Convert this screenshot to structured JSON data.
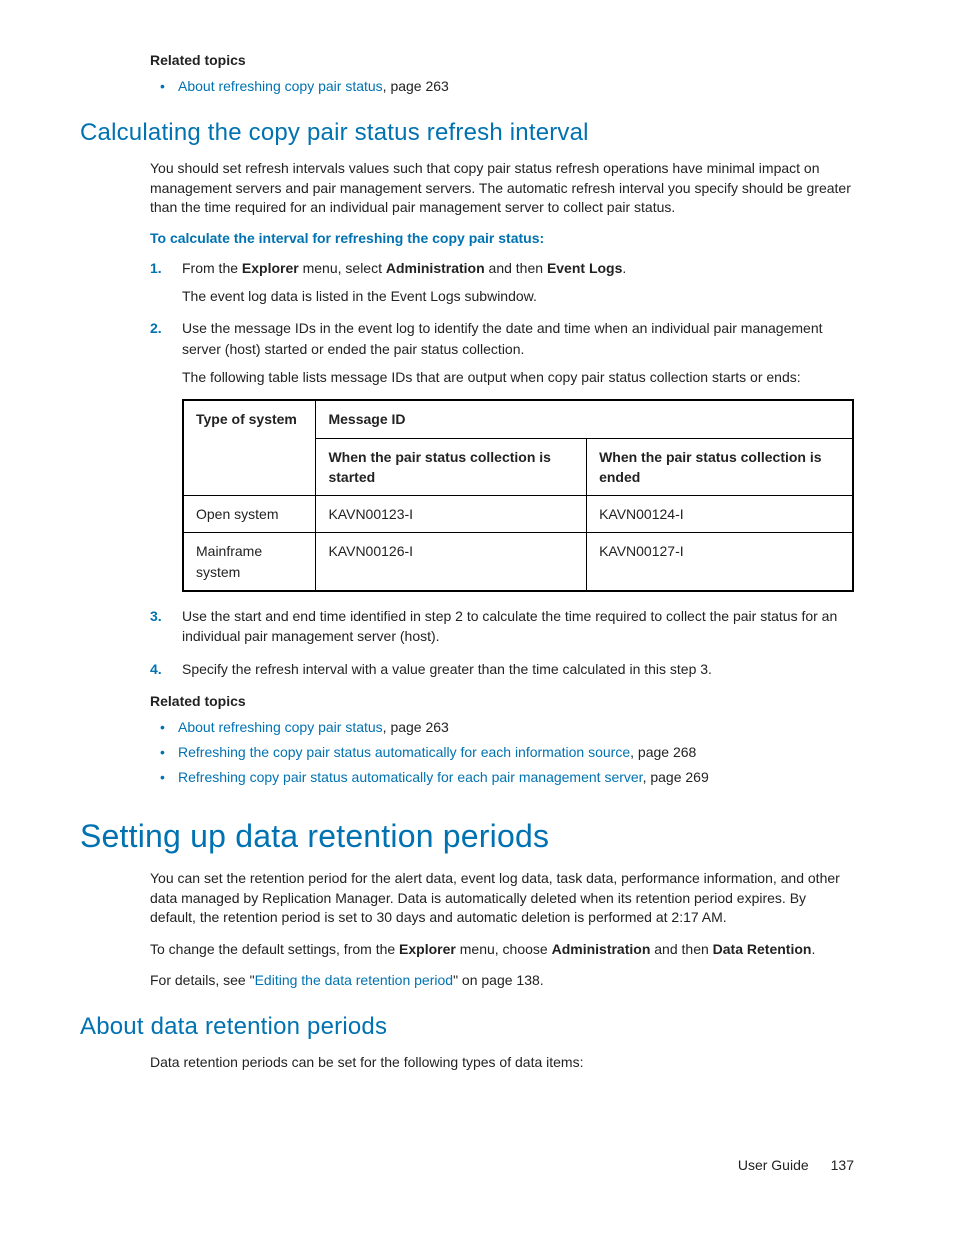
{
  "related1": {
    "heading": "Related topics",
    "items": [
      {
        "link": "About refreshing copy pair status",
        "suffix": ", page 263"
      }
    ]
  },
  "section1": {
    "title": "Calculating the copy pair status refresh interval",
    "p1": "You should set refresh intervals values such that copy pair status refresh operations have minimal impact on management servers and pair management servers. The automatic refresh interval you specify should be greater than the time required for an individual pair management server to collect pair status.",
    "proc_heading": "To calculate the interval for refreshing the copy pair status:",
    "step1_pre": "From the ",
    "step1_b1": "Explorer",
    "step1_mid1": " menu, select ",
    "step1_b2": "Administration",
    "step1_mid2": " and then ",
    "step1_b3": "Event Logs",
    "step1_post": ".",
    "step1_sub": "The event log data is listed in the Event Logs subwindow.",
    "step2": "Use the message IDs in the event log to identify the date and time when an individual pair management server (host) started or ended the pair status collection.",
    "step2_sub": "The following table lists message IDs that are output when copy pair status collection starts or ends:",
    "step3": "Use the start and end time identified in step 2 to calculate the time required to collect the pair status for an individual pair management server (host).",
    "step4": "Specify the refresh interval with a value greater than the time calculated in this step 3."
  },
  "table": {
    "h_type": "Type of system",
    "h_msg": "Message ID",
    "h_start": "When the pair status collection is started",
    "h_end": "When the pair status collection is ended",
    "rows": [
      {
        "type": "Open system",
        "start": "KAVN00123-I",
        "end": "KAVN00124-I"
      },
      {
        "type": "Mainframe system",
        "start": "KAVN00126-I",
        "end": "KAVN00127-I"
      }
    ]
  },
  "related2": {
    "heading": "Related topics",
    "items": [
      {
        "link": "About refreshing copy pair status",
        "suffix": ", page 263"
      },
      {
        "link": "Refreshing the copy pair status automatically for each information source",
        "suffix": ", page 268"
      },
      {
        "link": "Refreshing copy pair status automatically for each pair management server",
        "suffix": ", page 269"
      }
    ]
  },
  "section2": {
    "title": "Setting up data retention periods",
    "p1": "You can set the retention period for the alert data, event log data, task data, performance information, and other data managed by Replication Manager. Data is automatically deleted when its retention period expires. By default, the retention period is set to 30 days and automatic deletion is performed at 2:17 AM.",
    "p2_pre": "To change the default settings, from the ",
    "p2_b1": "Explorer",
    "p2_mid1": " menu, choose ",
    "p2_b2": "Administration",
    "p2_mid2": " and then ",
    "p2_b3": "Data Retention",
    "p2_post": ".",
    "p3_pre": "For details, see \"",
    "p3_link": "Editing the data retention period",
    "p3_post": "\" on page 138."
  },
  "section3": {
    "title": "About data retention periods",
    "p1": "Data retention periods can be set for the following types of data items:"
  },
  "footer": {
    "label": "User Guide",
    "page": "137"
  }
}
